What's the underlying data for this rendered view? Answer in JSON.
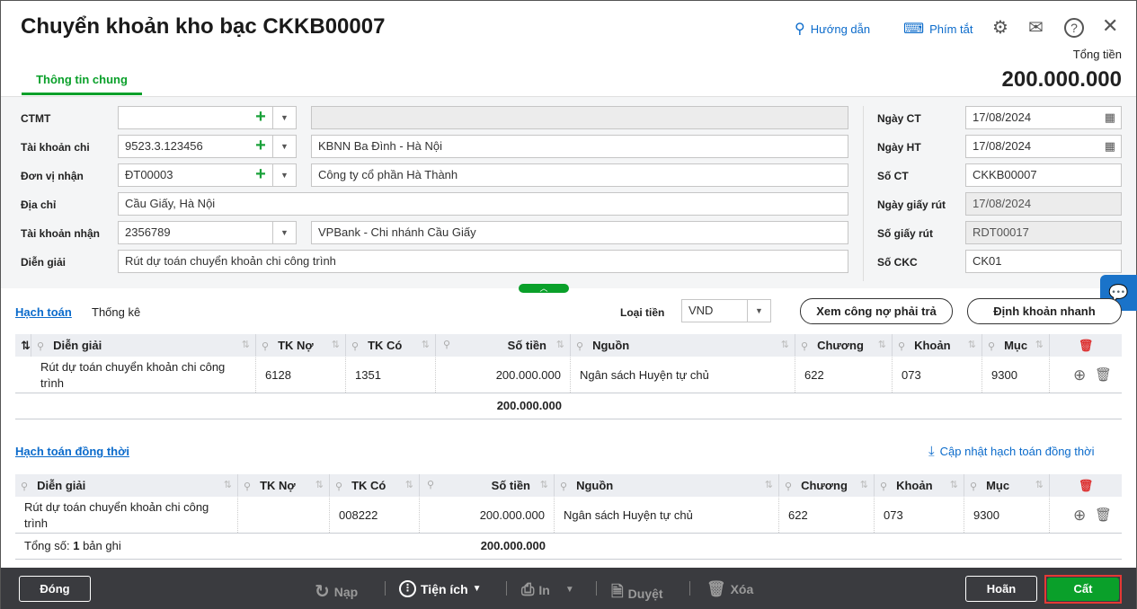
{
  "header": {
    "title": "Chuyển khoản kho bạc CKKB00007",
    "guide": "Hướng dẫn",
    "shortcuts": "Phím tắt",
    "total_label": "Tổng tiền",
    "total_value": "200.000.000",
    "icons": [
      "settings-icon",
      "mail-icon",
      "help-icon",
      "close-icon"
    ]
  },
  "tabs": [
    {
      "label": "Thông tin chung",
      "active": true
    }
  ],
  "form": {
    "ctmt": {
      "label": "CTMT",
      "value": "",
      "name": ""
    },
    "tk_chi": {
      "label": "Tài khoản chi",
      "value": "9523.3.123456",
      "name": "KBNN Ba Đình - Hà Nội"
    },
    "don_vi": {
      "label": "Đơn vị nhận",
      "value": "ĐT00003",
      "name": "Công ty cổ phần Hà Thành"
    },
    "dia_chi": {
      "label": "Địa chỉ",
      "value": "Cầu Giấy, Hà Nội"
    },
    "tk_nhan": {
      "label": "Tài khoản nhận",
      "value": "2356789",
      "name": "VPBank - Chi nhánh  Cầu Giấy"
    },
    "dien_giai": {
      "label": "Diễn giải",
      "value": "Rút dự toán chuyển khoản chi công trình"
    },
    "ngay_ct": {
      "label": "Ngày CT",
      "value": "17/08/2024"
    },
    "ngay_ht": {
      "label": "Ngày HT",
      "value": "17/08/2024"
    },
    "so_ct": {
      "label": "Số CT",
      "value": "CKKB00007"
    },
    "ngay_giay_rut": {
      "label": "Ngày giấy rút",
      "value": "17/08/2024"
    },
    "so_giay_rut": {
      "label": "Số giấy rút",
      "value": "RDT00017"
    },
    "so_ckc": {
      "label": "Số CKC",
      "value": "CK01"
    }
  },
  "section1": {
    "tab_active": "Hạch toán",
    "tab_other": "Thống kê",
    "currency_label": "Loại tiền",
    "currency": "VND",
    "btn_debt": "Xem công nợ phải trả",
    "btn_quick": "Định khoản nhanh",
    "columns": [
      "Diễn giải",
      "TK Nợ",
      "TK Có",
      "Số tiền",
      "Nguồn",
      "Chương",
      "Khoản",
      "Mục"
    ],
    "rows": [
      [
        "Rút dự toán chuyển khoản chi công trình",
        "6128",
        "1351",
        "200.000.000",
        "Ngân sách Huyện tự chủ",
        "622",
        "073",
        "9300"
      ]
    ],
    "total": "200.000.000"
  },
  "section2": {
    "title": "Hạch toán đồng thời",
    "update": "Cập nhật hạch toán đồng thời",
    "columns": [
      "Diễn giải",
      "TK Nợ",
      "TK Có",
      "Số tiền",
      "Nguồn",
      "Chương",
      "Khoản",
      "Mục"
    ],
    "rows": [
      [
        "Rút dự toán chuyển khoản chi công trình",
        "",
        "008222",
        "200.000.000",
        "Ngân sách Huyện tự chủ",
        "622",
        "073",
        "9300"
      ]
    ],
    "count_label": "Tổng số:",
    "count": "1",
    "count_unit": "bản ghi",
    "total": "200.000.000"
  },
  "footer": {
    "close": "Đóng",
    "reload": "Nạp",
    "utilities": "Tiện ích",
    "print": "In",
    "approve": "Duyệt",
    "delete": "Xóa",
    "cancel": "Hoãn",
    "save": "Cất",
    "save_color": "#0aa02a"
  }
}
